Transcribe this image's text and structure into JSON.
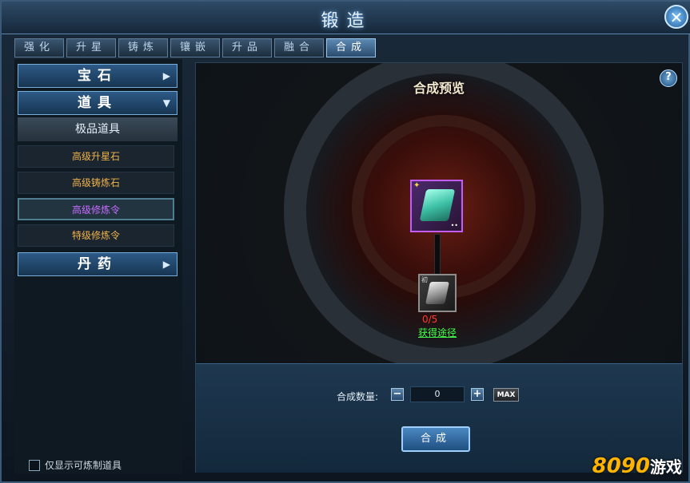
{
  "window": {
    "title": "锻造",
    "close_symbol": "✕"
  },
  "tabs": [
    {
      "label": "强化"
    },
    {
      "label": "升星"
    },
    {
      "label": "铸炼"
    },
    {
      "label": "镶嵌"
    },
    {
      "label": "升品"
    },
    {
      "label": "融合"
    },
    {
      "label": "合成",
      "active": true
    }
  ],
  "sidebar": {
    "categories": [
      {
        "label": "宝石",
        "arrow": "▶"
      },
      {
        "label": "道具",
        "arrow": "▼"
      },
      {
        "label": "丹药",
        "arrow": "▶"
      }
    ],
    "subheading": "极品道具",
    "items": [
      {
        "label": "高级升星石"
      },
      {
        "label": "高级铸炼石"
      },
      {
        "label": "高级修炼令",
        "selected": true
      },
      {
        "label": "特级修炼令"
      }
    ],
    "filter_label": "仅显示可炼制道具"
  },
  "preview": {
    "title": "合成预览",
    "help": "?",
    "material_count": "0/5",
    "source_link": "获得途径",
    "sub_tag": "初"
  },
  "controls": {
    "quantity_label": "合成数量:",
    "quantity_value": "0",
    "minus": "−",
    "plus": "+",
    "max_label": "MAX",
    "craft_label": "合成"
  },
  "watermark": {
    "text": "8090",
    "suffix": "游戏"
  },
  "colors": {
    "accent": "#79aedb",
    "selected_item": "#c66bff",
    "item_text": "#f0b24a",
    "count_red": "#ff3a2e",
    "link_green": "#42ff4a"
  }
}
